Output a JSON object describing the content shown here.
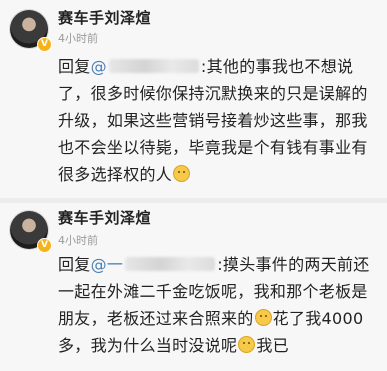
{
  "comments": [
    {
      "author": "赛车手刘泽煊",
      "time": "4小时前",
      "reply_prefix": "回复",
      "mention": "@",
      "text": ":其他的事我也不想说了，很多时候你保持沉默换来的只是误解的升级，如果这些营销号接着炒这些事，那我也不会坐以待毙，毕竟我是个有钱有事业有很多选择权的人"
    },
    {
      "author": "赛车手刘泽煊",
      "time": "4小时前",
      "reply_prefix": "回复",
      "mention": "@一",
      "text_1": ":摸头事件的两天前还一起在外滩二千金吃饭呢，我和那个老板是朋友，老板还过来合照来的",
      "text_2": "花了我4000多，我为什么当时没说呢",
      "text_3": "我已"
    }
  ],
  "colors": {
    "mention": "#4a7fb5",
    "badge": "#f6b21a",
    "background": "#f7f7f7"
  },
  "icons": {
    "verified_badge": "v-badge-icon",
    "emoji": "smile-emoji-icon"
  }
}
